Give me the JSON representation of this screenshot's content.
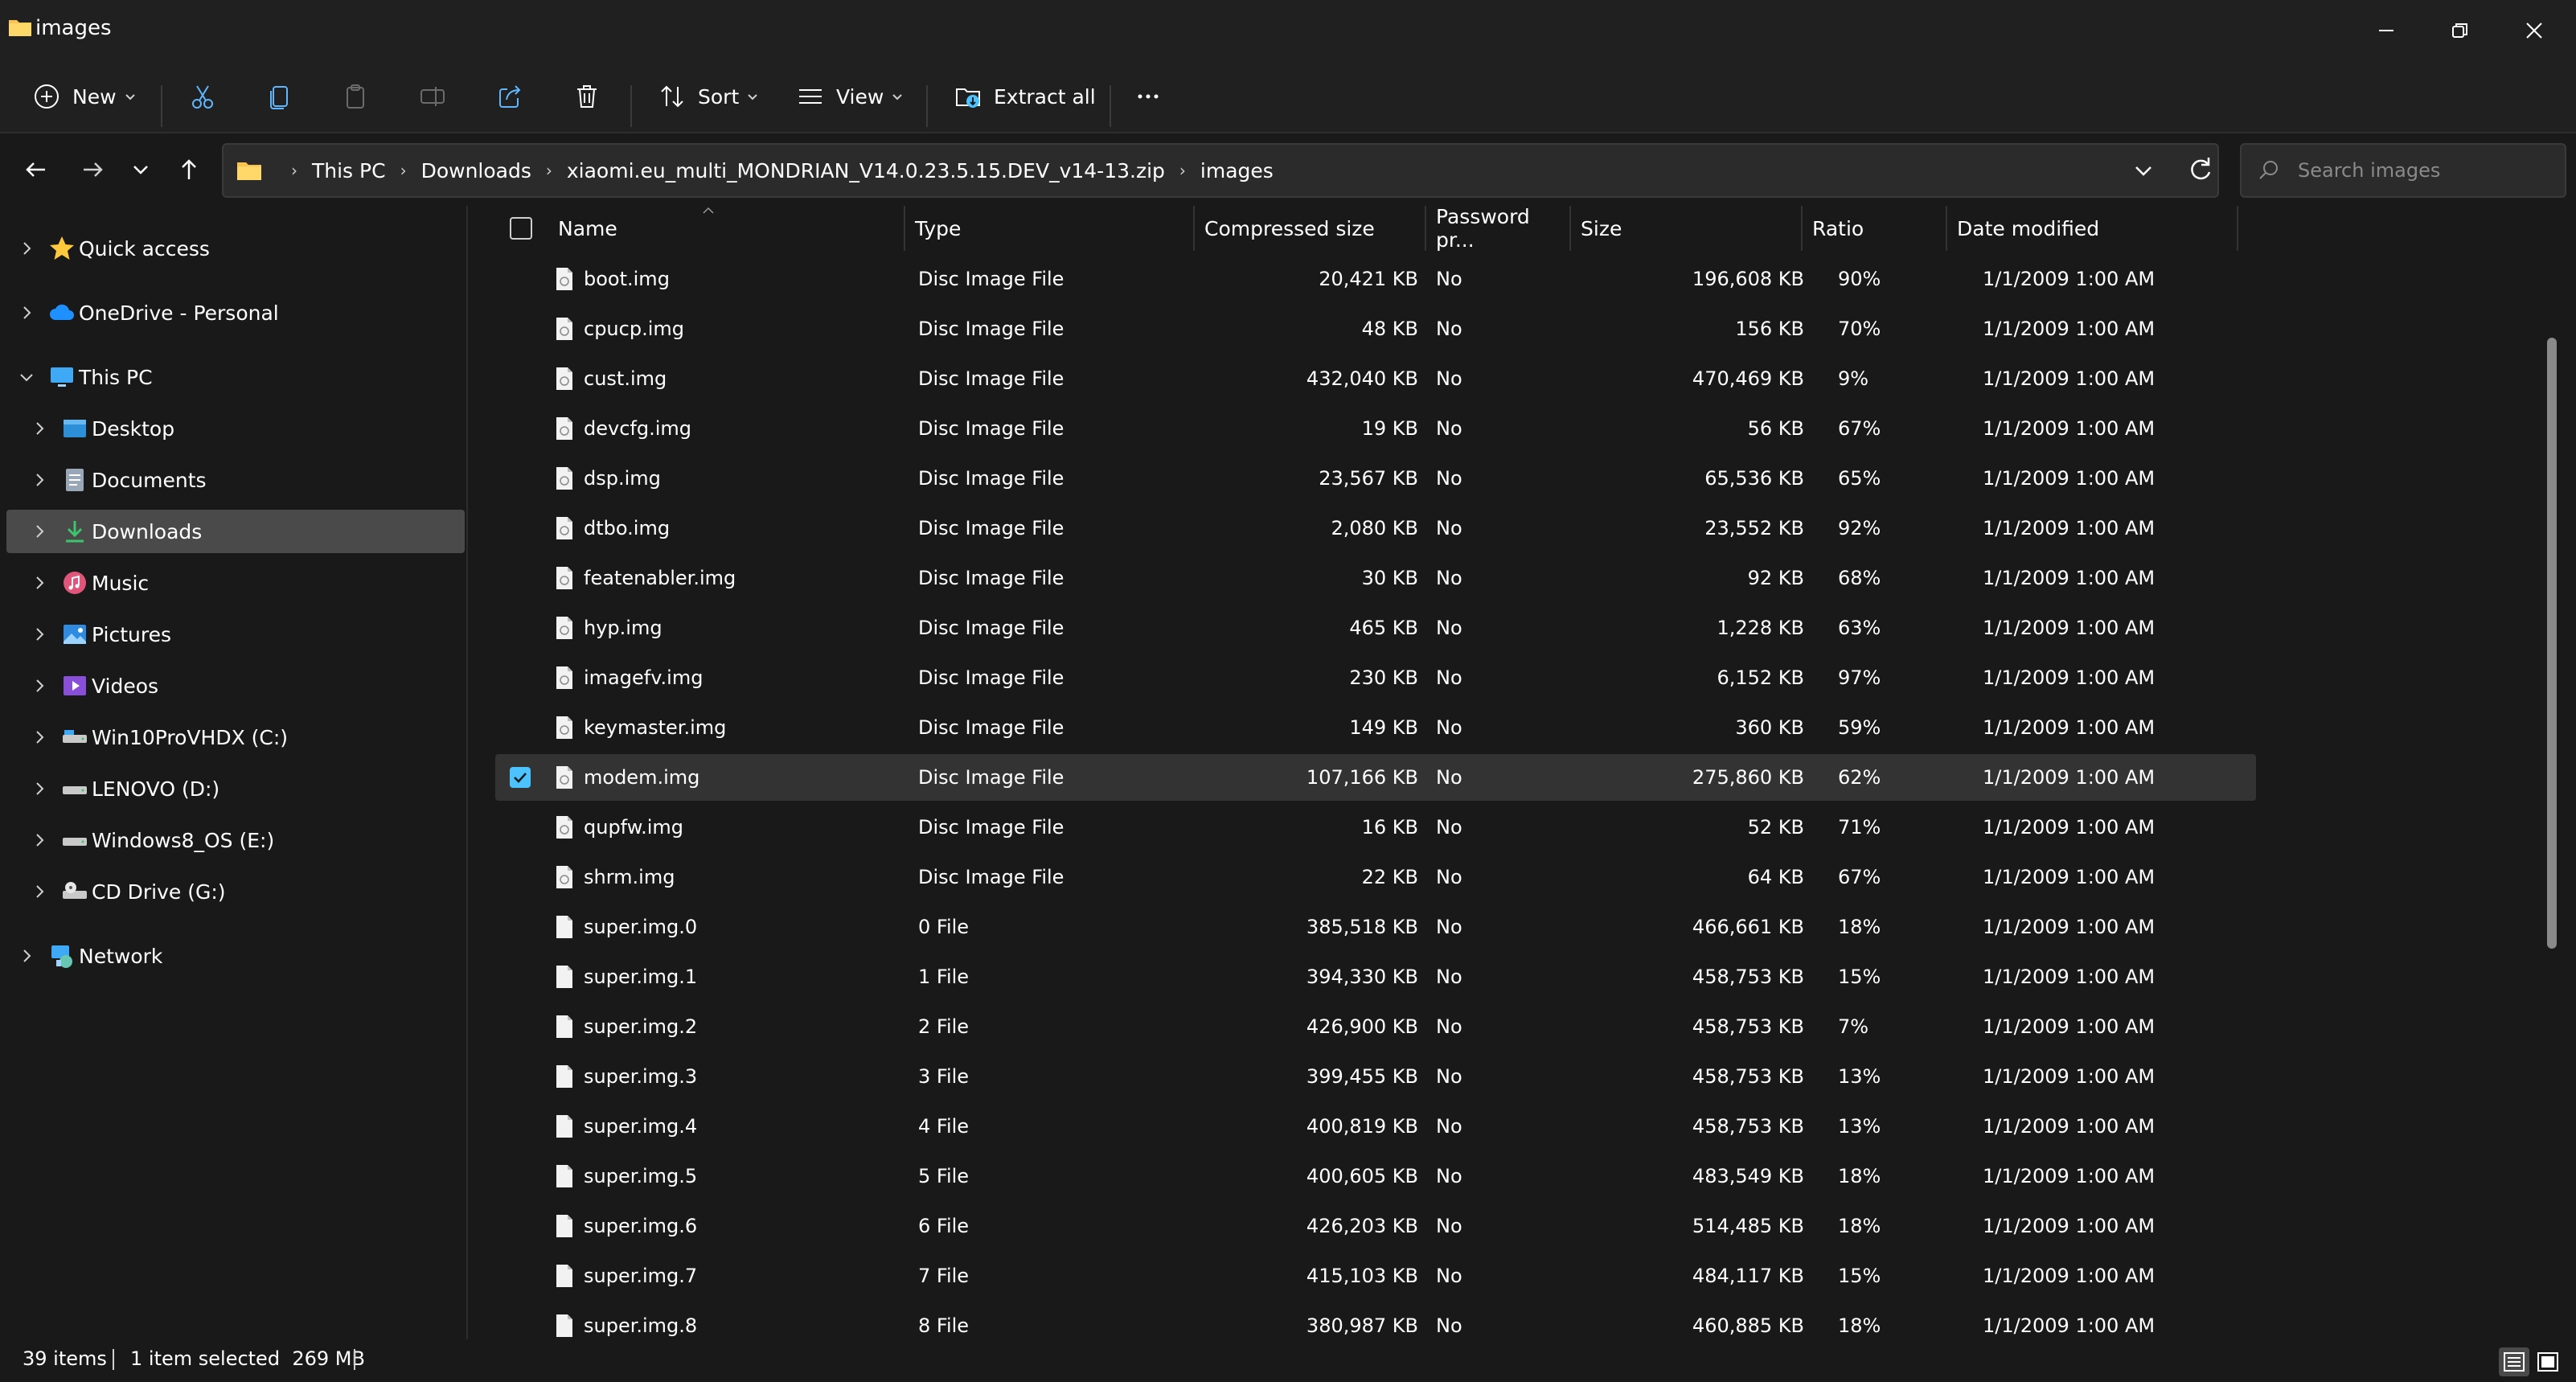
{
  "window": {
    "title": "images"
  },
  "toolbar": {
    "new_label": "New",
    "sort_label": "Sort",
    "view_label": "View",
    "extract_all_label": "Extract all"
  },
  "address": {
    "crumbs": [
      "This PC",
      "Downloads",
      "xiaomi.eu_multi_MONDRIAN_V14.0.23.5.15.DEV_v14-13.zip",
      "images"
    ]
  },
  "search": {
    "placeholder": "Search images"
  },
  "nav_pane": {
    "items": [
      {
        "label": "Quick access",
        "icon": "star-icon"
      },
      {
        "label": "OneDrive - Personal",
        "icon": "cloud-icon"
      },
      {
        "label": "This PC",
        "icon": "computer-icon"
      },
      {
        "label": "Desktop",
        "icon": "desktop-icon"
      },
      {
        "label": "Documents",
        "icon": "documents-icon"
      },
      {
        "label": "Downloads",
        "icon": "downloads-icon"
      },
      {
        "label": "Music",
        "icon": "music-icon"
      },
      {
        "label": "Pictures",
        "icon": "pictures-icon"
      },
      {
        "label": "Videos",
        "icon": "videos-icon"
      },
      {
        "label": "Win10ProVHDX (C:)",
        "icon": "drive-icon"
      },
      {
        "label": "LENOVO (D:)",
        "icon": "drive-icon"
      },
      {
        "label": "Windows8_OS (E:)",
        "icon": "drive-icon"
      },
      {
        "label": "CD Drive (G:)",
        "icon": "cd-drive-icon"
      },
      {
        "label": "Network",
        "icon": "network-icon"
      }
    ]
  },
  "columns": {
    "name": "Name",
    "type": "Type",
    "compressed_size": "Compressed size",
    "password": "Password pr...",
    "size": "Size",
    "ratio": "Ratio",
    "date_modified": "Date modified"
  },
  "files": [
    {
      "name": "boot.img",
      "type": "Disc Image File",
      "compressed": "20,421 KB",
      "password": "No",
      "size": "196,608 KB",
      "ratio": "90%",
      "date": "1/1/2009 1:00 AM"
    },
    {
      "name": "cpucp.img",
      "type": "Disc Image File",
      "compressed": "48 KB",
      "password": "No",
      "size": "156 KB",
      "ratio": "70%",
      "date": "1/1/2009 1:00 AM"
    },
    {
      "name": "cust.img",
      "type": "Disc Image File",
      "compressed": "432,040 KB",
      "password": "No",
      "size": "470,469 KB",
      "ratio": "9%",
      "date": "1/1/2009 1:00 AM"
    },
    {
      "name": "devcfg.img",
      "type": "Disc Image File",
      "compressed": "19 KB",
      "password": "No",
      "size": "56 KB",
      "ratio": "67%",
      "date": "1/1/2009 1:00 AM"
    },
    {
      "name": "dsp.img",
      "type": "Disc Image File",
      "compressed": "23,567 KB",
      "password": "No",
      "size": "65,536 KB",
      "ratio": "65%",
      "date": "1/1/2009 1:00 AM"
    },
    {
      "name": "dtbo.img",
      "type": "Disc Image File",
      "compressed": "2,080 KB",
      "password": "No",
      "size": "23,552 KB",
      "ratio": "92%",
      "date": "1/1/2009 1:00 AM"
    },
    {
      "name": "featenabler.img",
      "type": "Disc Image File",
      "compressed": "30 KB",
      "password": "No",
      "size": "92 KB",
      "ratio": "68%",
      "date": "1/1/2009 1:00 AM"
    },
    {
      "name": "hyp.img",
      "type": "Disc Image File",
      "compressed": "465 KB",
      "password": "No",
      "size": "1,228 KB",
      "ratio": "63%",
      "date": "1/1/2009 1:00 AM"
    },
    {
      "name": "imagefv.img",
      "type": "Disc Image File",
      "compressed": "230 KB",
      "password": "No",
      "size": "6,152 KB",
      "ratio": "97%",
      "date": "1/1/2009 1:00 AM"
    },
    {
      "name": "keymaster.img",
      "type": "Disc Image File",
      "compressed": "149 KB",
      "password": "No",
      "size": "360 KB",
      "ratio": "59%",
      "date": "1/1/2009 1:00 AM"
    },
    {
      "name": "modem.img",
      "type": "Disc Image File",
      "compressed": "107,166 KB",
      "password": "No",
      "size": "275,860 KB",
      "ratio": "62%",
      "date": "1/1/2009 1:00 AM"
    },
    {
      "name": "qupfw.img",
      "type": "Disc Image File",
      "compressed": "16 KB",
      "password": "No",
      "size": "52 KB",
      "ratio": "71%",
      "date": "1/1/2009 1:00 AM"
    },
    {
      "name": "shrm.img",
      "type": "Disc Image File",
      "compressed": "22 KB",
      "password": "No",
      "size": "64 KB",
      "ratio": "67%",
      "date": "1/1/2009 1:00 AM"
    },
    {
      "name": "super.img.0",
      "type": "0 File",
      "compressed": "385,518 KB",
      "password": "No",
      "size": "466,661 KB",
      "ratio": "18%",
      "date": "1/1/2009 1:00 AM"
    },
    {
      "name": "super.img.1",
      "type": "1 File",
      "compressed": "394,330 KB",
      "password": "No",
      "size": "458,753 KB",
      "ratio": "15%",
      "date": "1/1/2009 1:00 AM"
    },
    {
      "name": "super.img.2",
      "type": "2 File",
      "compressed": "426,900 KB",
      "password": "No",
      "size": "458,753 KB",
      "ratio": "7%",
      "date": "1/1/2009 1:00 AM"
    },
    {
      "name": "super.img.3",
      "type": "3 File",
      "compressed": "399,455 KB",
      "password": "No",
      "size": "458,753 KB",
      "ratio": "13%",
      "date": "1/1/2009 1:00 AM"
    },
    {
      "name": "super.img.4",
      "type": "4 File",
      "compressed": "400,819 KB",
      "password": "No",
      "size": "458,753 KB",
      "ratio": "13%",
      "date": "1/1/2009 1:00 AM"
    },
    {
      "name": "super.img.5",
      "type": "5 File",
      "compressed": "400,605 KB",
      "password": "No",
      "size": "483,549 KB",
      "ratio": "18%",
      "date": "1/1/2009 1:00 AM"
    },
    {
      "name": "super.img.6",
      "type": "6 File",
      "compressed": "426,203 KB",
      "password": "No",
      "size": "514,485 KB",
      "ratio": "18%",
      "date": "1/1/2009 1:00 AM"
    },
    {
      "name": "super.img.7",
      "type": "7 File",
      "compressed": "415,103 KB",
      "password": "No",
      "size": "484,117 KB",
      "ratio": "15%",
      "date": "1/1/2009 1:00 AM"
    },
    {
      "name": "super.img.8",
      "type": "8 File",
      "compressed": "380,987 KB",
      "password": "No",
      "size": "460,885 KB",
      "ratio": "18%",
      "date": "1/1/2009 1:00 AM"
    }
  ],
  "status": {
    "item_count": "39 items",
    "selection": "1 item selected  269 MB"
  },
  "colors": {
    "accent": "#4cc2ff",
    "background": "#191919",
    "chrome": "#202020",
    "selected_row": "#333333"
  }
}
